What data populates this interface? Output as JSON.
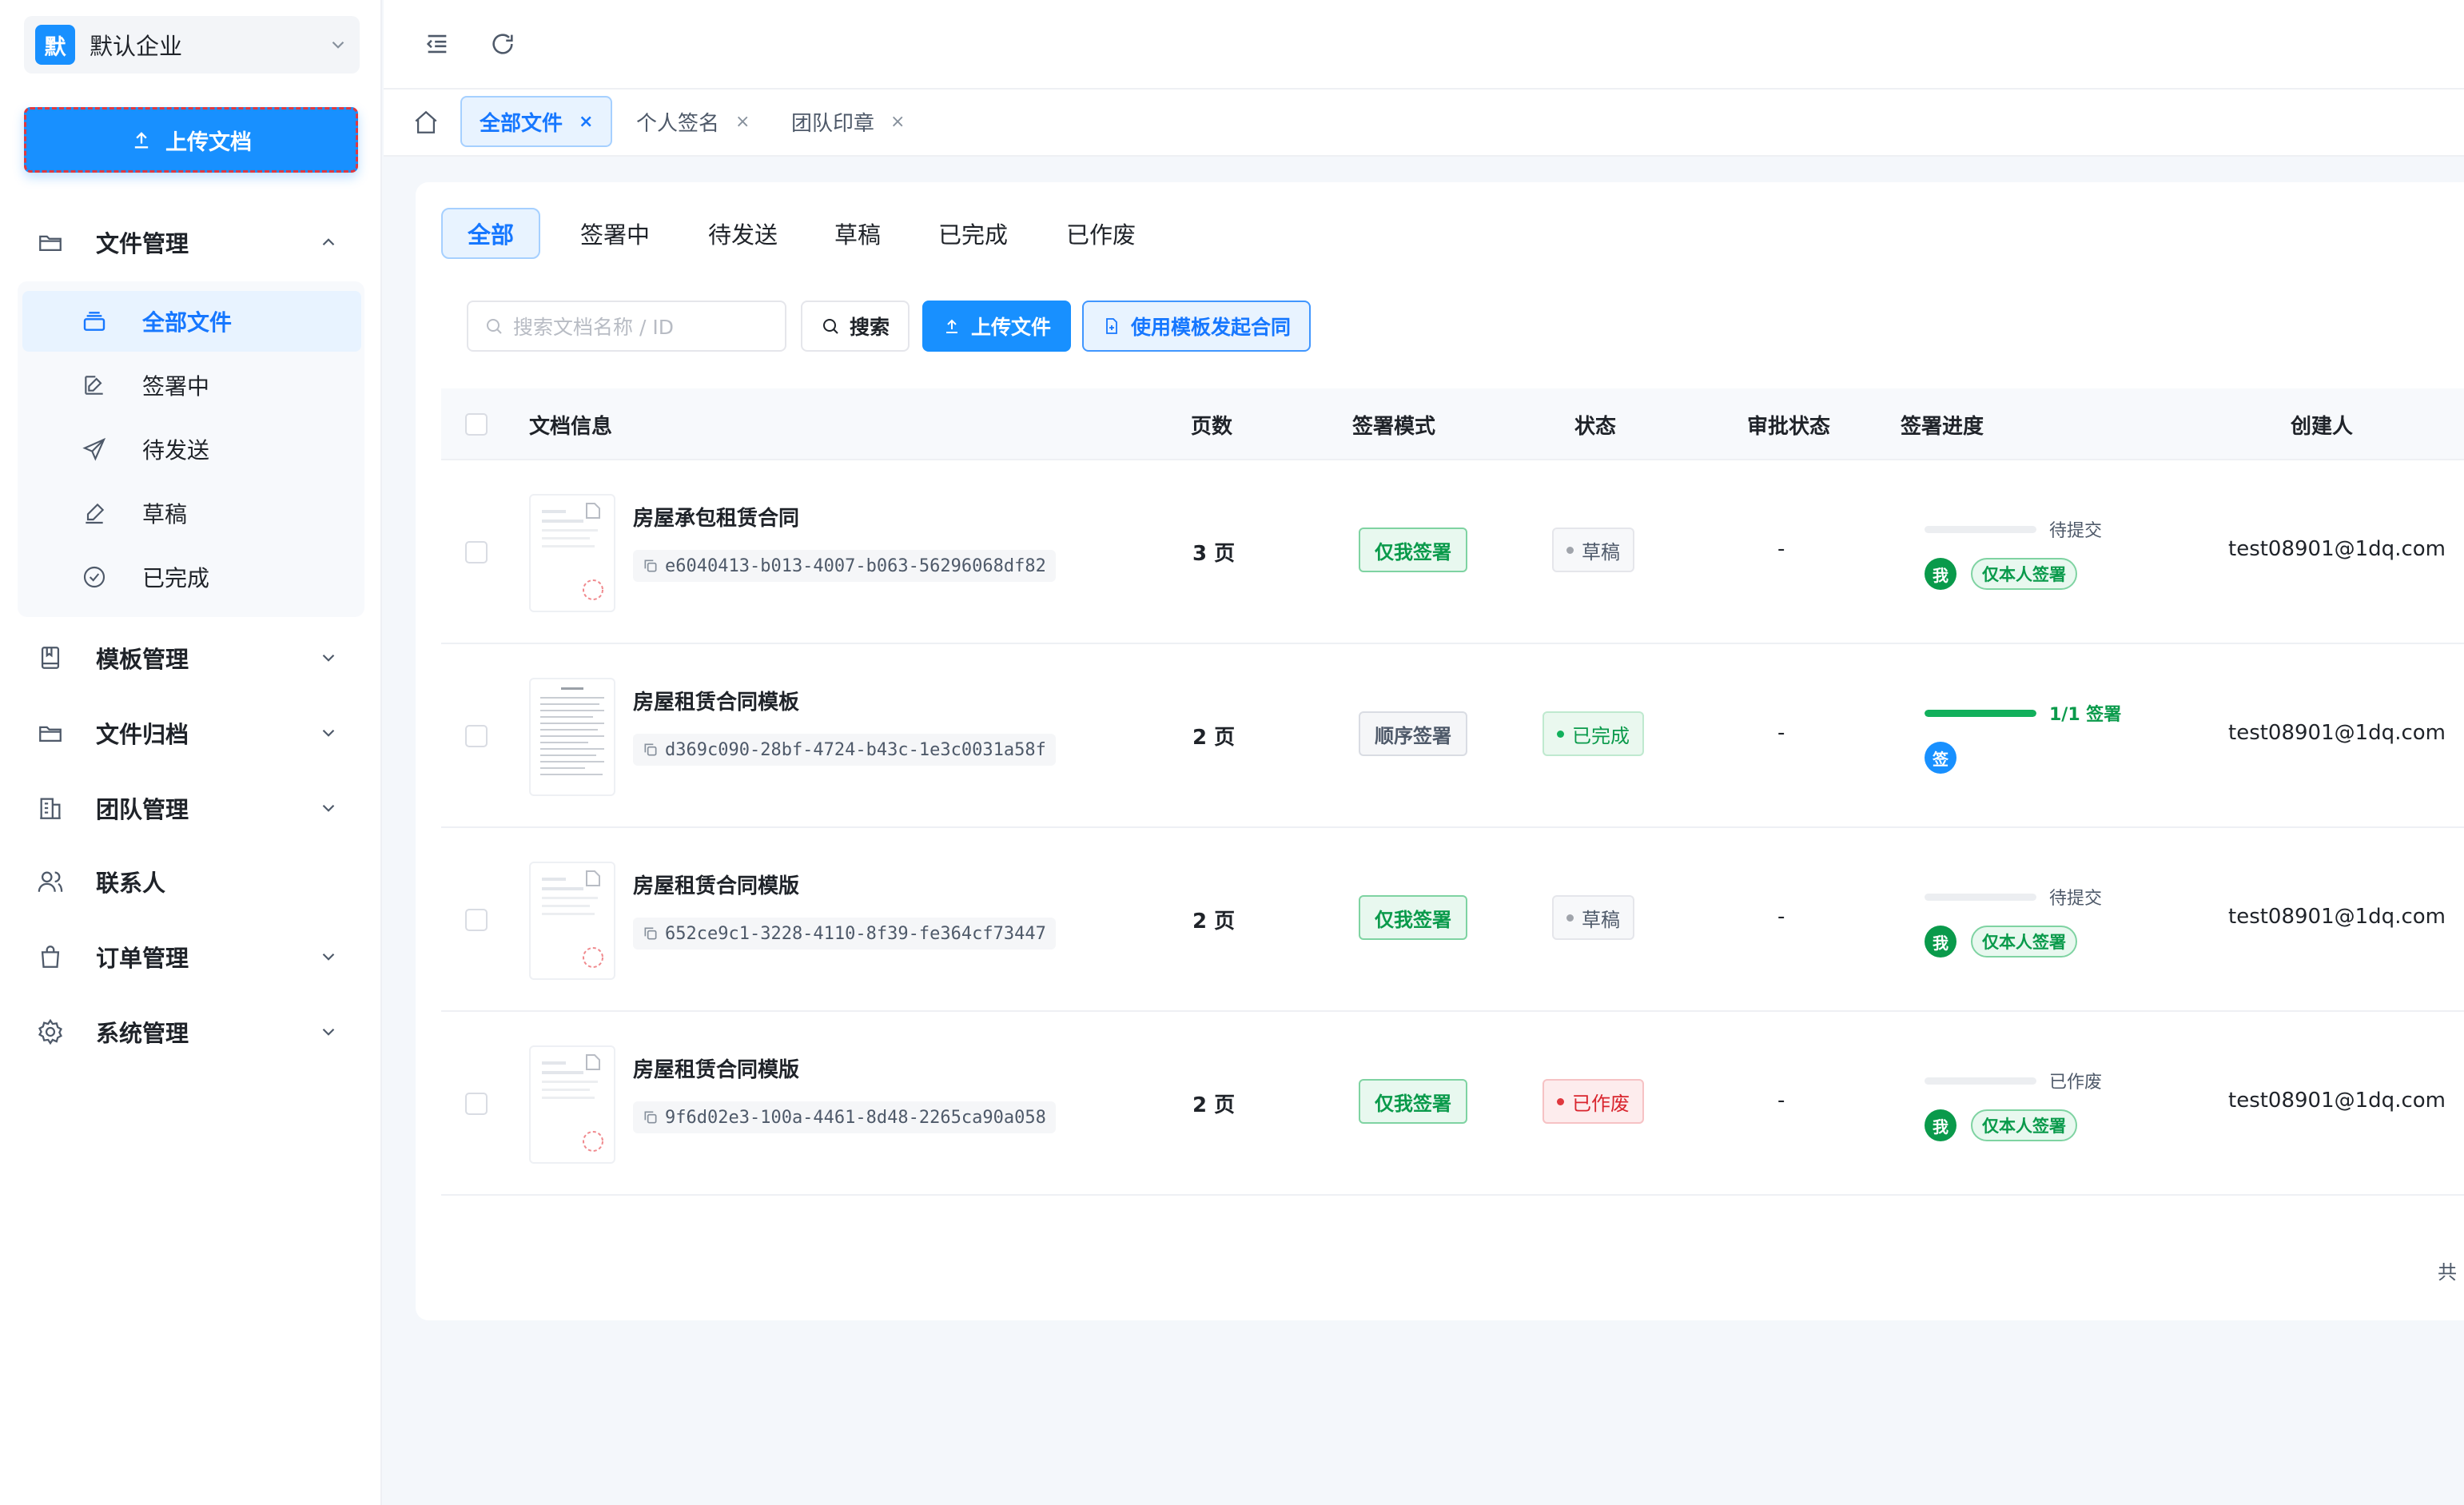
{
  "sidebar": {
    "company": {
      "logo": "默",
      "name": "默认企业"
    },
    "upload_label": "上传文档",
    "nav": {
      "files": "文件管理",
      "templates": "模板管理",
      "archive": "文件归档",
      "team": "团队管理",
      "contacts": "联系人",
      "orders": "订单管理",
      "system": "系统管理"
    },
    "sub": {
      "all": "全部文件",
      "signing": "签署中",
      "pending": "待发送",
      "draft": "草稿",
      "completed": "已完成"
    }
  },
  "tabs": [
    {
      "label": "全部文件",
      "close": "×"
    },
    {
      "label": "个人签名",
      "close": "×"
    },
    {
      "label": "团队印章",
      "close": "×"
    }
  ],
  "filter_tabs": [
    "全部",
    "签署中",
    "待发送",
    "草稿",
    "已完成",
    "已作废"
  ],
  "toolbar": {
    "search_placeholder": "搜索文档名称 / ID",
    "search_label": "搜索",
    "upload_label": "上传文件",
    "template_label": "使用模板发起合同"
  },
  "table": {
    "headers": {
      "doc": "文档信息",
      "pages": "页数",
      "mode": "签署模式",
      "status": "状态",
      "approval": "审批状态",
      "progress": "签署进度",
      "creator": "创建人"
    },
    "rows": [
      {
        "title": "房屋承包租赁合同",
        "id": "e6040413-b013-4007-b063-56296068df82",
        "pages": "3 页",
        "mode": "仅我签署",
        "status": "草稿",
        "approval": "-",
        "progress_text": "待提交",
        "progress_fraction": 0,
        "avatar": "我",
        "signer_tag": "仅本人签署",
        "creator": "test08901@1dq.com"
      },
      {
        "title": "房屋租赁合同模板",
        "id": "d369c090-28bf-4724-b43c-1e3c0031a58f",
        "pages": "2 页",
        "mode": "顺序签署",
        "status": "已完成",
        "approval": "-",
        "progress_text": "1/1 签署",
        "progress_fraction": 1,
        "avatar": "签",
        "signer_tag": "",
        "creator": "test08901@1dq.com"
      },
      {
        "title": "房屋租赁合同模版",
        "id": "652ce9c1-3228-4110-8f39-fe364cf73447",
        "pages": "2 页",
        "mode": "仅我签署",
        "status": "草稿",
        "approval": "-",
        "progress_text": "待提交",
        "progress_fraction": 0,
        "avatar": "我",
        "signer_tag": "仅本人签署",
        "creator": "test08901@1dq.com"
      },
      {
        "title": "房屋租赁合同模版",
        "id": "9f6d02e3-100a-4461-8d48-2265ca90a058",
        "pages": "2 页",
        "mode": "仅我签署",
        "status": "已作废",
        "approval": "-",
        "progress_text": "已作废",
        "progress_fraction": 0,
        "avatar": "我",
        "signer_tag": "仅本人签署",
        "creator": "test08901@1dq.com"
      }
    ]
  },
  "footer_partial": "共",
  "colors": {
    "primary": "#1890ff",
    "success": "#12b05c",
    "danger": "#e0383e"
  }
}
